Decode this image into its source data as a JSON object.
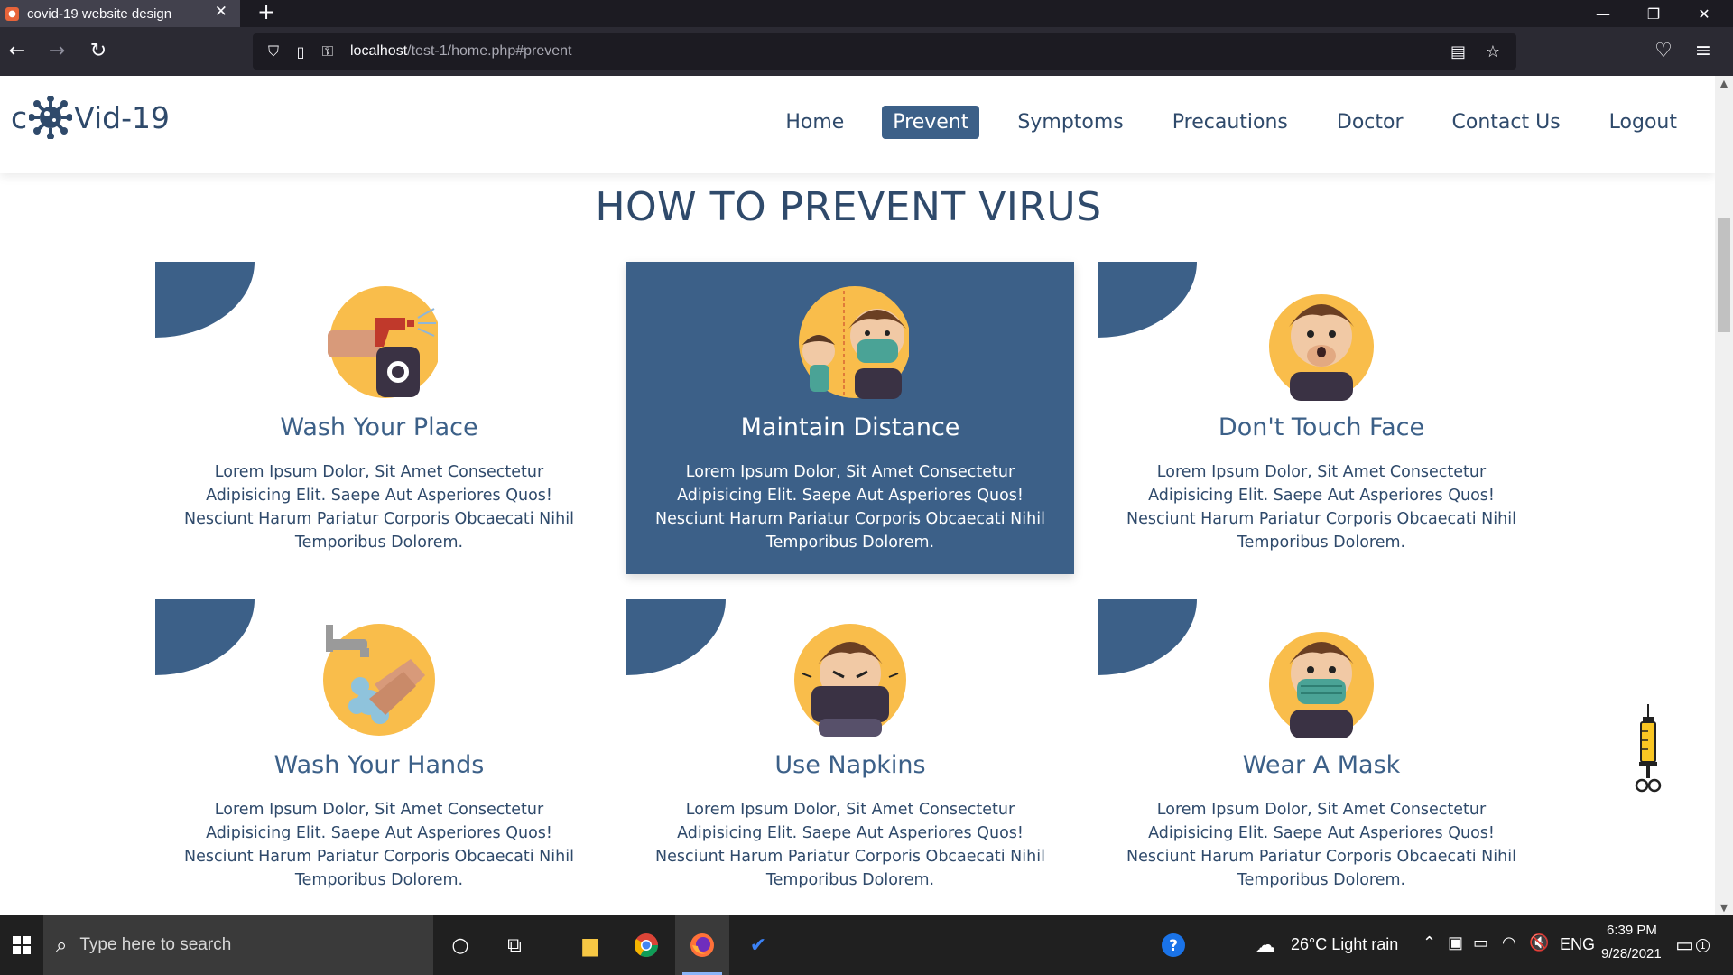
{
  "browser": {
    "tab_title": "covid-19 website design",
    "url_host": "localhost",
    "url_path": "/test-1/home.php#prevent"
  },
  "site": {
    "logo_pre": "c",
    "logo_post": "Vid-19",
    "nav": [
      {
        "label": "Home",
        "active": false
      },
      {
        "label": "Prevent",
        "active": true
      },
      {
        "label": "Symptoms",
        "active": false
      },
      {
        "label": "Precautions",
        "active": false
      },
      {
        "label": "Doctor",
        "active": false
      },
      {
        "label": "Contact Us",
        "active": false
      },
      {
        "label": "Logout",
        "active": false
      }
    ],
    "heading": "HOW TO PREVENT VIRUS"
  },
  "cards": [
    {
      "title": "Wash Your Place",
      "icon": "spray-bottle-icon",
      "text": "Lorem Ipsum Dolor, Sit Amet Consectetur Adipisicing Elit. Saepe Aut Asperiores Quos! Nesciunt Harum Pariatur Corporis Obcaecati Nihil Temporibus Dolorem."
    },
    {
      "title": "Maintain Distance",
      "icon": "social-distance-icon",
      "text": "Lorem Ipsum Dolor, Sit Amet Consectetur Adipisicing Elit. Saepe Aut Asperiores Quos! Nesciunt Harum Pariatur Corporis Obcaecati Nihil Temporibus Dolorem."
    },
    {
      "title": "Don't Touch Face",
      "icon": "touch-face-icon",
      "text": "Lorem Ipsum Dolor, Sit Amet Consectetur Adipisicing Elit. Saepe Aut Asperiores Quos! Nesciunt Harum Pariatur Corporis Obcaecati Nihil Temporibus Dolorem."
    },
    {
      "title": "Wash Your Hands",
      "icon": "wash-hands-icon",
      "text": "Lorem Ipsum Dolor, Sit Amet Consectetur Adipisicing Elit. Saepe Aut Asperiores Quos! Nesciunt Harum Pariatur Corporis Obcaecati Nihil Temporibus Dolorem."
    },
    {
      "title": "Use Napkins",
      "icon": "napkin-icon",
      "text": "Lorem Ipsum Dolor, Sit Amet Consectetur Adipisicing Elit. Saepe Aut Asperiores Quos! Nesciunt Harum Pariatur Corporis Obcaecati Nihil Temporibus Dolorem."
    },
    {
      "title": "Wear A Mask",
      "icon": "face-mask-icon",
      "text": "Lorem Ipsum Dolor, Sit Amet Consectetur Adipisicing Elit. Saepe Aut Asperiores Quos! Nesciunt Harum Pariatur Corporis Obcaecati Nihil Temporibus Dolorem."
    }
  ],
  "taskbar": {
    "search_placeholder": "Type here to search",
    "weather": "26°C  Light rain",
    "lang": "ENG",
    "time": "6:39 PM",
    "date": "9/28/2021",
    "notification_count": "1"
  },
  "colors": {
    "primary": "#3c6088",
    "heading": "#2f4a6b",
    "accent_yellow": "#f9bd4b"
  }
}
